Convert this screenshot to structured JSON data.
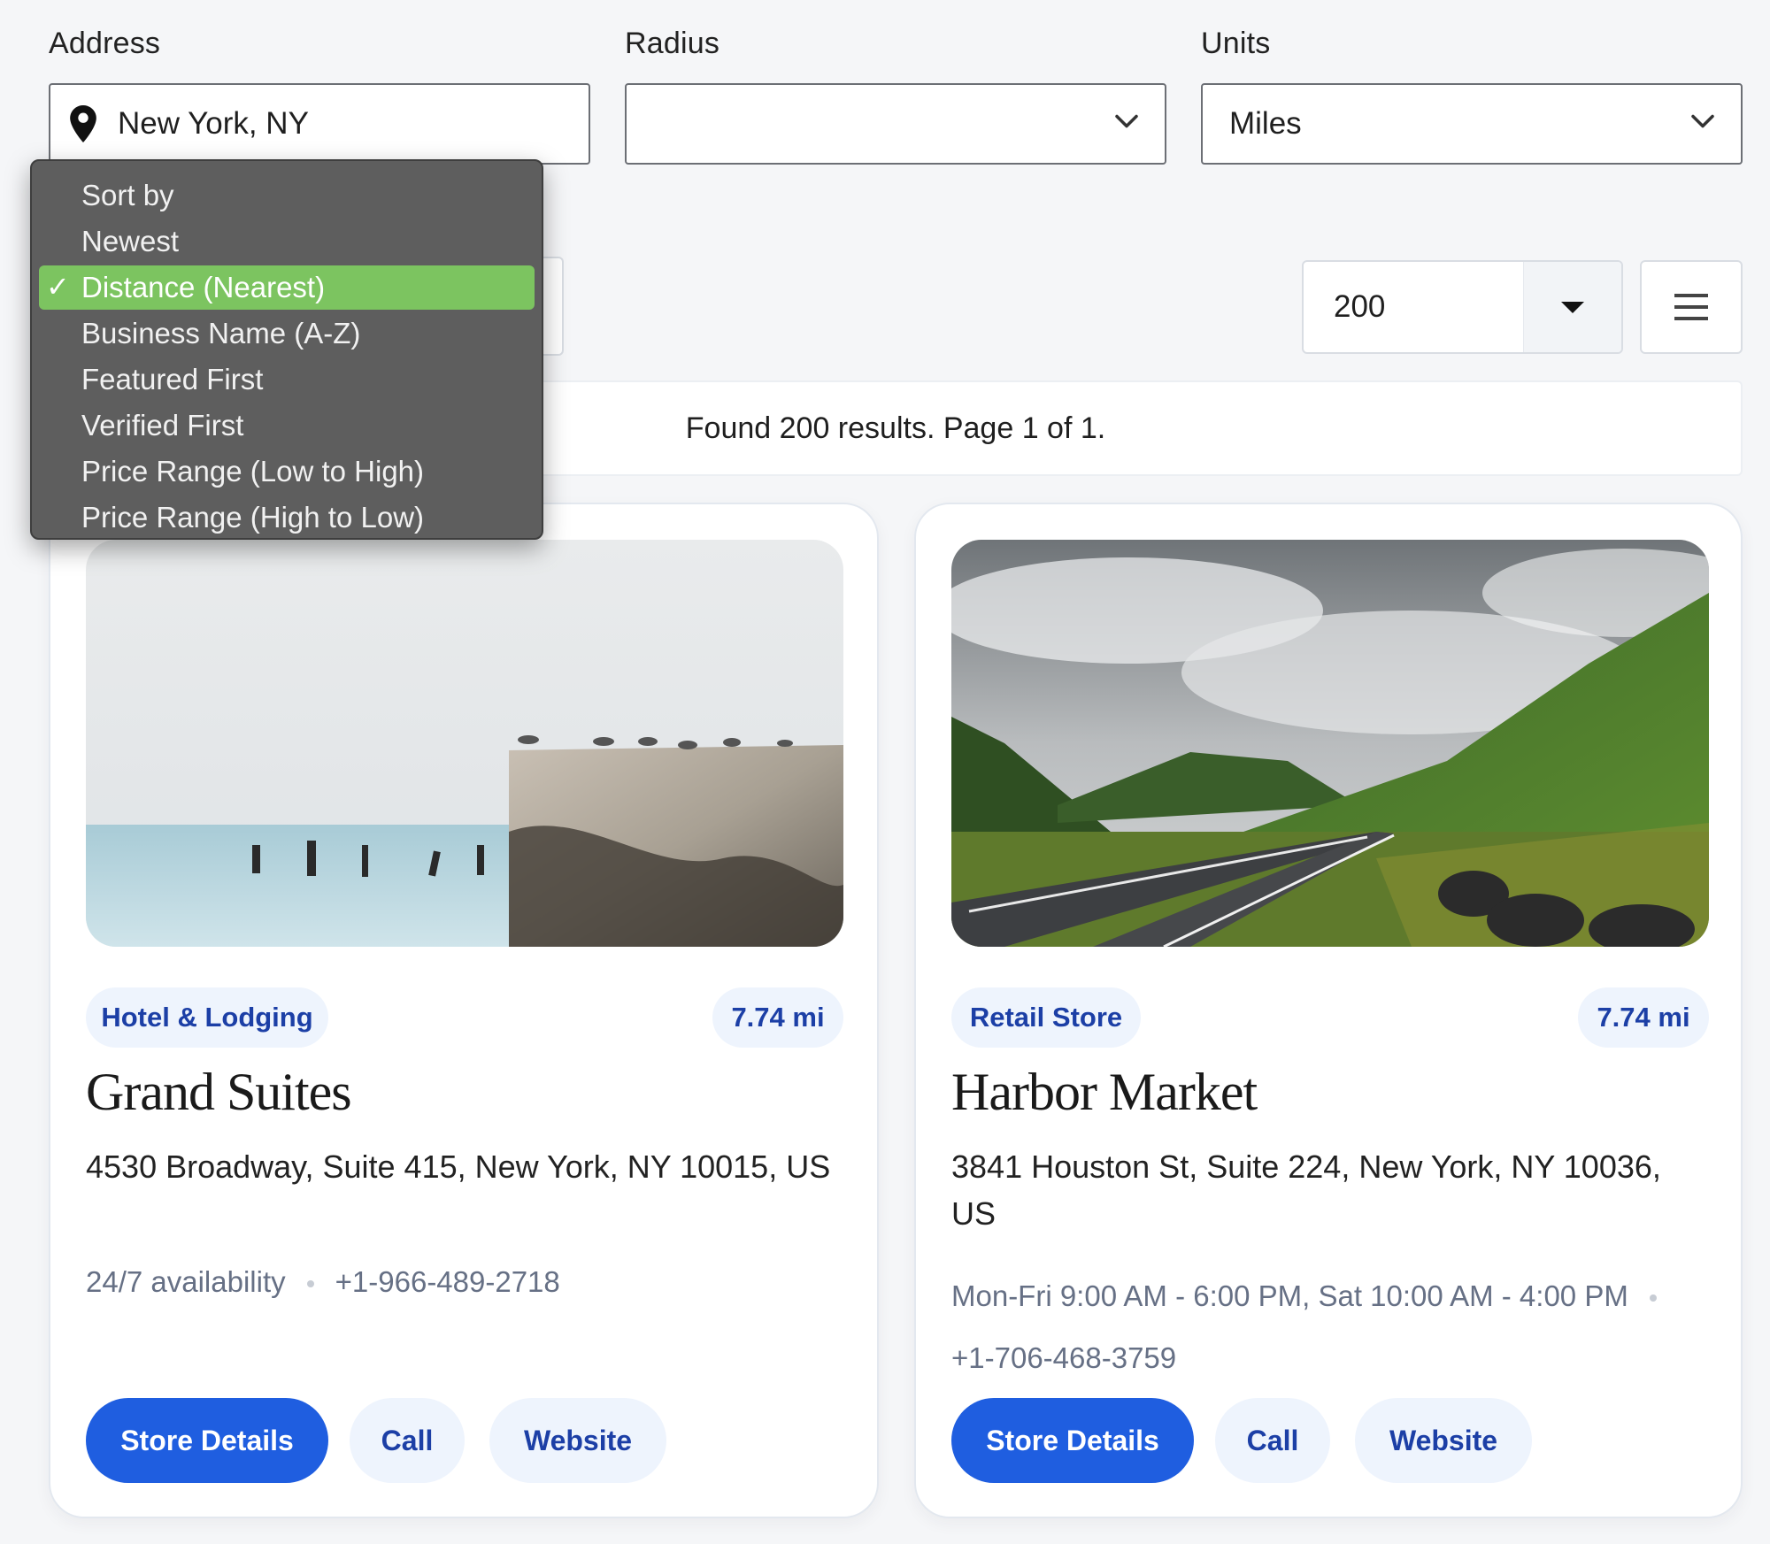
{
  "filters": {
    "address": {
      "label": "Address",
      "value": "New York, NY"
    },
    "radius": {
      "label": "Radius",
      "value": ""
    },
    "units": {
      "label": "Units",
      "value": "Miles"
    }
  },
  "per_page": {
    "value": "200"
  },
  "results": {
    "summary": "Found 200 results. Page 1 of 1."
  },
  "sort_menu": {
    "options": [
      "Sort by",
      "Newest",
      "Distance (Nearest)",
      "Business Name (A-Z)",
      "Featured First",
      "Verified First",
      "Price Range (Low to High)",
      "Price Range (High to Low)"
    ],
    "selected": "Distance (Nearest)",
    "check": "✓"
  },
  "cards": [
    {
      "category": "Hotel & Lodging",
      "distance": "7.74 mi",
      "name": "Grand Suites",
      "address": "4530 Broadway, Suite 415, New York, NY 10015, US",
      "hours": "24/7 availability",
      "phone": "+1-966-489-2718",
      "buttons": {
        "details": "Store Details",
        "call": "Call",
        "website": "Website"
      }
    },
    {
      "category": "Retail Store",
      "distance": "7.74 mi",
      "name": "Harbor Market",
      "address": "3841 Houston St, Suite 224, New York, NY 10036, US",
      "hours": "Mon-Fri 9:00 AM - 6:00 PM, Sat 10:00 AM - 4:00 PM",
      "phone": "+1-706-468-3759",
      "buttons": {
        "details": "Store Details",
        "call": "Call",
        "website": "Website"
      }
    }
  ],
  "colors": {
    "primary": "#1f5ee0",
    "chip_bg": "#eef4fd",
    "chip_text": "#1c3fa6",
    "menu_bg": "#5e5e5e",
    "menu_selected": "#7cc460"
  },
  "icons": [
    "map-pin-icon",
    "chevron-down-icon",
    "caret-down-icon",
    "hamburger-menu-icon",
    "checkmark-icon"
  ]
}
